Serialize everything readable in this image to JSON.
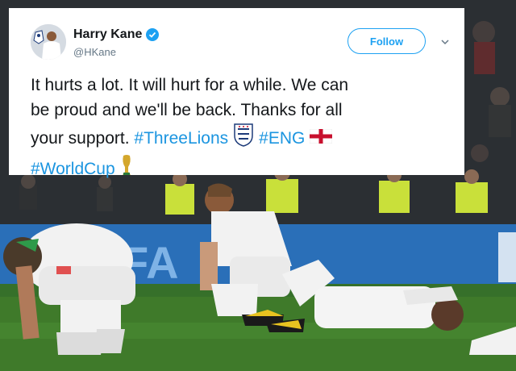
{
  "tweet": {
    "display_name": "Harry Kane",
    "handle": "@HKane",
    "follow_label": "Follow",
    "text_lines": [
      "It hurts a lot. It will hurt for a while. We can",
      "be proud and we'll be back. Thanks for all",
      "your support."
    ],
    "hashtags": [
      "#ThreeLions",
      "#ENG",
      "#WorldCup"
    ],
    "emojis": [
      "three-lions-crest-icon",
      "england-flag-icon",
      "world-cup-trophy-icon"
    ]
  },
  "background": {
    "hoarding_text": "FA",
    "colors": {
      "pitch": "#3f7a2a",
      "hoarding": "#2a6fb8",
      "kit": "#f2f2f2"
    }
  }
}
